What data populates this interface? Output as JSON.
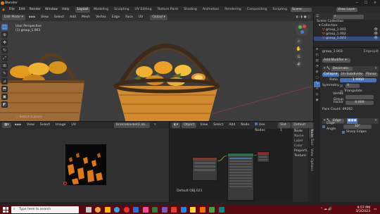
{
  "window": {
    "title": "Blender"
  },
  "menubar": {
    "items": [
      "File",
      "Edit",
      "Render",
      "Window",
      "Help"
    ],
    "workspaces": [
      "Layout",
      "Modeling",
      "Sculpting",
      "UV Editing",
      "Texture Paint",
      "Shading",
      "Animation",
      "Rendering",
      "Compositing",
      "Scripting"
    ],
    "active_workspace": "Layout",
    "scene": "Scene",
    "view_layer": "View Layer"
  },
  "viewport": {
    "mode": "Edit Mode",
    "menus": [
      "View",
      "Select",
      "Add",
      "Mesh",
      "Vertex",
      "Edge",
      "Face",
      "UV"
    ],
    "orientation": "Global",
    "perspective": "User Perspective",
    "object_label": "(1) group_1.003",
    "status_hint": "Select (Lasso)"
  },
  "outliner": {
    "root": "Scene Collection",
    "collection": "Collection",
    "items": [
      "group_1.001",
      "group_1.002",
      "group_1.003"
    ],
    "selected": "group_1.003"
  },
  "properties": {
    "object_name": "group_1.003",
    "data_name": "Edgesplit",
    "add_modifier": "Add Modifier",
    "decimate": {
      "name": "Decimate",
      "modes": [
        "Collapse",
        "Un-Subdivide",
        "Planar"
      ],
      "active_mode": "Collapse",
      "ratio_label": "Ratio",
      "ratio_value": "1.0000",
      "symmetry_label": "Symmetry",
      "triangulate_label": "Triangulate",
      "vertex_group_label": "Vertex Group",
      "factor_label": "Factor",
      "factor_value": "0.000",
      "face_count": "Face Count: 49282"
    },
    "edge_split": {
      "name": "Edge",
      "edge_angle_label": "Edge Angle",
      "edge_angle_value": "30°",
      "sharp_edges_label": "Sharp Edges"
    }
  },
  "uv_editor": {
    "menus": [
      "View",
      "Select",
      "Image",
      "UV"
    ],
    "image_name": "bronzebasket2.ab..."
  },
  "node_editor": {
    "object_type": "Object",
    "menus": [
      "View",
      "Select",
      "Add",
      "Node"
    ],
    "use_nodes": "Use Nodes",
    "slot": "Slot 1",
    "material": "Default OBJ",
    "footer_label": "Default OBJ.021",
    "side_tabs": [
      "Node",
      "Tool",
      "View",
      "Options"
    ],
    "side_labels": [
      "Node",
      "Name",
      "Label",
      "Color",
      "Properti...",
      "Texture"
    ]
  },
  "taskbar": {
    "search_placeholder": "Type here to search",
    "time": "9:57 PM",
    "date": "3/3/2023"
  }
}
